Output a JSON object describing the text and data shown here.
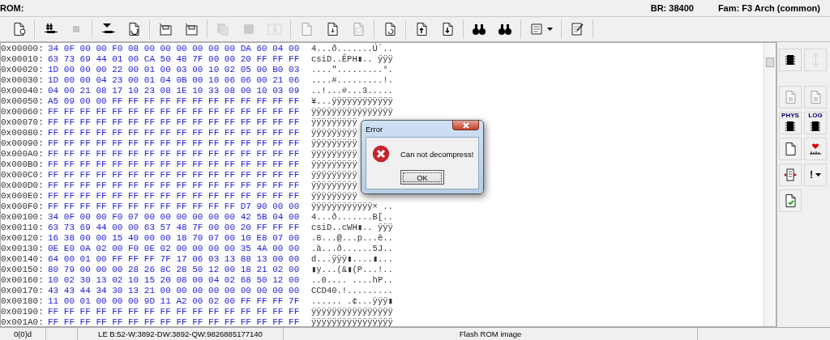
{
  "header": {
    "rom_label": "ROM:",
    "baud": "BR: 38400",
    "family": "Fam: F3 Arch (common)"
  },
  "toolbar": {
    "groups": [
      [
        {
          "disabled": false
        }
      ],
      [
        {
          "disabled": false
        },
        {
          "disabled": true
        }
      ],
      [
        {
          "disabled": false
        },
        {
          "disabled": false
        }
      ],
      [
        {
          "disabled": false
        },
        {
          "disabled": false
        }
      ],
      [
        {
          "disabled": true
        },
        {
          "disabled": true
        },
        {
          "disabled": true
        }
      ],
      [
        {
          "disabled": true
        },
        {
          "disabled": false
        },
        {
          "disabled": true
        }
      ],
      [
        {
          "disabled": false
        }
      ],
      [
        {
          "disabled": false
        },
        {
          "disabled": false
        }
      ],
      [
        {
          "disabled": false
        },
        {
          "disabled": false
        }
      ],
      [
        {
          "disabled": false
        }
      ],
      [
        {
          "disabled": false
        }
      ]
    ]
  },
  "hex_view": {
    "rows": [
      {
        "address": "0x00000:",
        "bytes": "34 0F 00 00 F0 08 00 00 00 00 00 00 DA 60 04 00",
        "ascii": "4...ð.......Ú`.."
      },
      {
        "address": "0x00010:",
        "bytes": "63 73 69 44 01 00 CA 50 48 7F 00 00 20 FF FF FF",
        "ascii": "csiD..ÊPH▮.. ÿÿÿ"
      },
      {
        "address": "0x00020:",
        "bytes": "1D 00 00 00 22 00 01 00 03 00 10 02 05 00 B0 03",
        "ascii": "....\".........°."
      },
      {
        "address": "0x00030:",
        "bytes": "1D 00 00 04 23 00 01 04 0B 00 10 06 06 00 21 06",
        "ascii": "....#.........!."
      },
      {
        "address": "0x00040:",
        "bytes": "04 00 21 08 17 10 23 08 1E 10 33 08 00 10 03 09",
        "ascii": "..!...#...3....."
      },
      {
        "address": "0x00050:",
        "bytes": "A5 09 00 00 FF FF FF FF FF FF FF FF FF FF FF FF",
        "ascii": "¥...ÿÿÿÿÿÿÿÿÿÿÿÿ"
      },
      {
        "address": "0x00060:",
        "bytes": "FF FF FF FF FF FF FF FF FF FF FF FF FF FF FF FF",
        "ascii": "ÿÿÿÿÿÿÿÿÿÿÿÿÿÿÿÿ"
      },
      {
        "address": "0x00070:",
        "bytes": "FF FF FF FF FF FF FF FF FF FF FF FF FF FF FF FF",
        "ascii": "ÿÿÿÿÿÿÿÿÿ"
      },
      {
        "address": "0x00080:",
        "bytes": "FF FF FF FF FF FF FF FF FF FF FF FF FF FF FF FF",
        "ascii": "ÿÿÿÿÿÿÿÿÿ"
      },
      {
        "address": "0x00090:",
        "bytes": "FF FF FF FF FF FF FF FF FF FF FF FF FF FF FF FF",
        "ascii": "ÿÿÿÿÿÿÿÿÿ"
      },
      {
        "address": "0x000A0:",
        "bytes": "FF FF FF FF FF FF FF FF FF FF FF FF FF FF FF FF",
        "ascii": "ÿÿÿÿÿÿÿÿÿ"
      },
      {
        "address": "0x000B0:",
        "bytes": "FF FF FF FF FF FF FF FF FF FF FF FF FF FF FF FF",
        "ascii": "ÿÿÿÿÿÿÿÿÿ"
      },
      {
        "address": "0x000C0:",
        "bytes": "FF FF FF FF FF FF FF FF FF FF FF FF FF FF FF FF",
        "ascii": "ÿÿÿÿÿÿÿÿÿ"
      },
      {
        "address": "0x000D0:",
        "bytes": "FF FF FF FF FF FF FF FF FF FF FF FF FF FF FF FF",
        "ascii": "ÿÿÿÿÿÿÿÿÿ"
      },
      {
        "address": "0x000E0:",
        "bytes": "FF FF FF FF FF FF FF FF FF FF FF FF FF FF FF FF",
        "ascii": "ÿÿÿÿÿÿÿÿÿ"
      },
      {
        "address": "0x000F0:",
        "bytes": "FF FF FF FF FF FF FF FF FF FF FF FF D7 90 00 00",
        "ascii": "ÿÿÿÿÿÿÿÿÿÿÿÿ× .."
      },
      {
        "address": "0x00100:",
        "bytes": "34 0F 00 00 F0 07 00 00 00 00 00 00 42 5B 04 00",
        "ascii": "4...ð.......B[.."
      },
      {
        "address": "0x00110:",
        "bytes": "63 73 69 44 00 00 63 57 48 7F 00 00 20 FF FF FF",
        "ascii": "csiD..cWH▮.. ÿÿÿ"
      },
      {
        "address": "0x00120:",
        "bytes": "16 38 00 00 15 40 00 00 18 70 07 00 10 E8 07 00",
        "ascii": ".8...@...p...è.."
      },
      {
        "address": "0x00130:",
        "bytes": "0E E0 0A 02 00 F0 0E 02 00 00 00 00 35 4A 00 00",
        "ascii": ".à...ð......5J.."
      },
      {
        "address": "0x00140:",
        "bytes": "64 00 01 00 FF FF FF 7F 17 06 03 13 88 13 00 00",
        "ascii": "d...ÿÿÿ▮....▮..."
      },
      {
        "address": "0x00150:",
        "bytes": "80 79 00 00 00 28 26 8C 28 50 12 00 18 21 02 00",
        "ascii": "▮y...(&▮(P...!.."
      },
      {
        "address": "0x00160:",
        "bytes": "10 02 30 13 02 10 15 20 08 00 04 02 68 50 12 00",
        "ascii": "..0.... ....hP.."
      },
      {
        "address": "0x00170:",
        "bytes": "43 43 44 34 30 13 21 00 00 00 00 00 00 00 00 00",
        "ascii": "CCD40.!........."
      },
      {
        "address": "0x00180:",
        "bytes": "11 00 01 00 00 00 9D 11 A2 00 02 00 FF FF FF 7F",
        "ascii": "...... .¢...ÿÿÿ▮"
      },
      {
        "address": "0x00190:",
        "bytes": "FF FF FF FF FF FF FF FF FF FF FF FF FF FF FF FF",
        "ascii": "ÿÿÿÿÿÿÿÿÿÿÿÿÿÿÿÿ"
      },
      {
        "address": "0x001A0:",
        "bytes": "FF FF FF FF FF FF FF FF FF FF FF FF FF FF FF FF",
        "ascii": "ÿÿÿÿÿÿÿÿÿÿÿÿÿÿÿÿ"
      }
    ]
  },
  "side_toolbar": {
    "rows": [
      [
        {
          "disabled": false
        },
        {
          "disabled": true
        }
      ],
      [
        {
          "disabled": true
        },
        {
          "disabled": true
        }
      ],
      [
        {
          "disabled": false,
          "label": "PHYS"
        },
        {
          "disabled": false,
          "label": "LOG"
        }
      ],
      [
        {
          "disabled": false
        },
        {
          "disabled": false
        }
      ],
      [
        {
          "disabled": false
        },
        {
          "disabled": false,
          "label": "!"
        }
      ],
      [
        {
          "disabled": false
        }
      ]
    ]
  },
  "dialog": {
    "title": "Error",
    "message": "Can not decompress!",
    "button": "OK"
  },
  "status_bar": {
    "position": "0(0)d",
    "value_info": "LE B:52-W:3892-DW:3892-QW:9826885177140",
    "file_type": "Flash ROM image"
  }
}
